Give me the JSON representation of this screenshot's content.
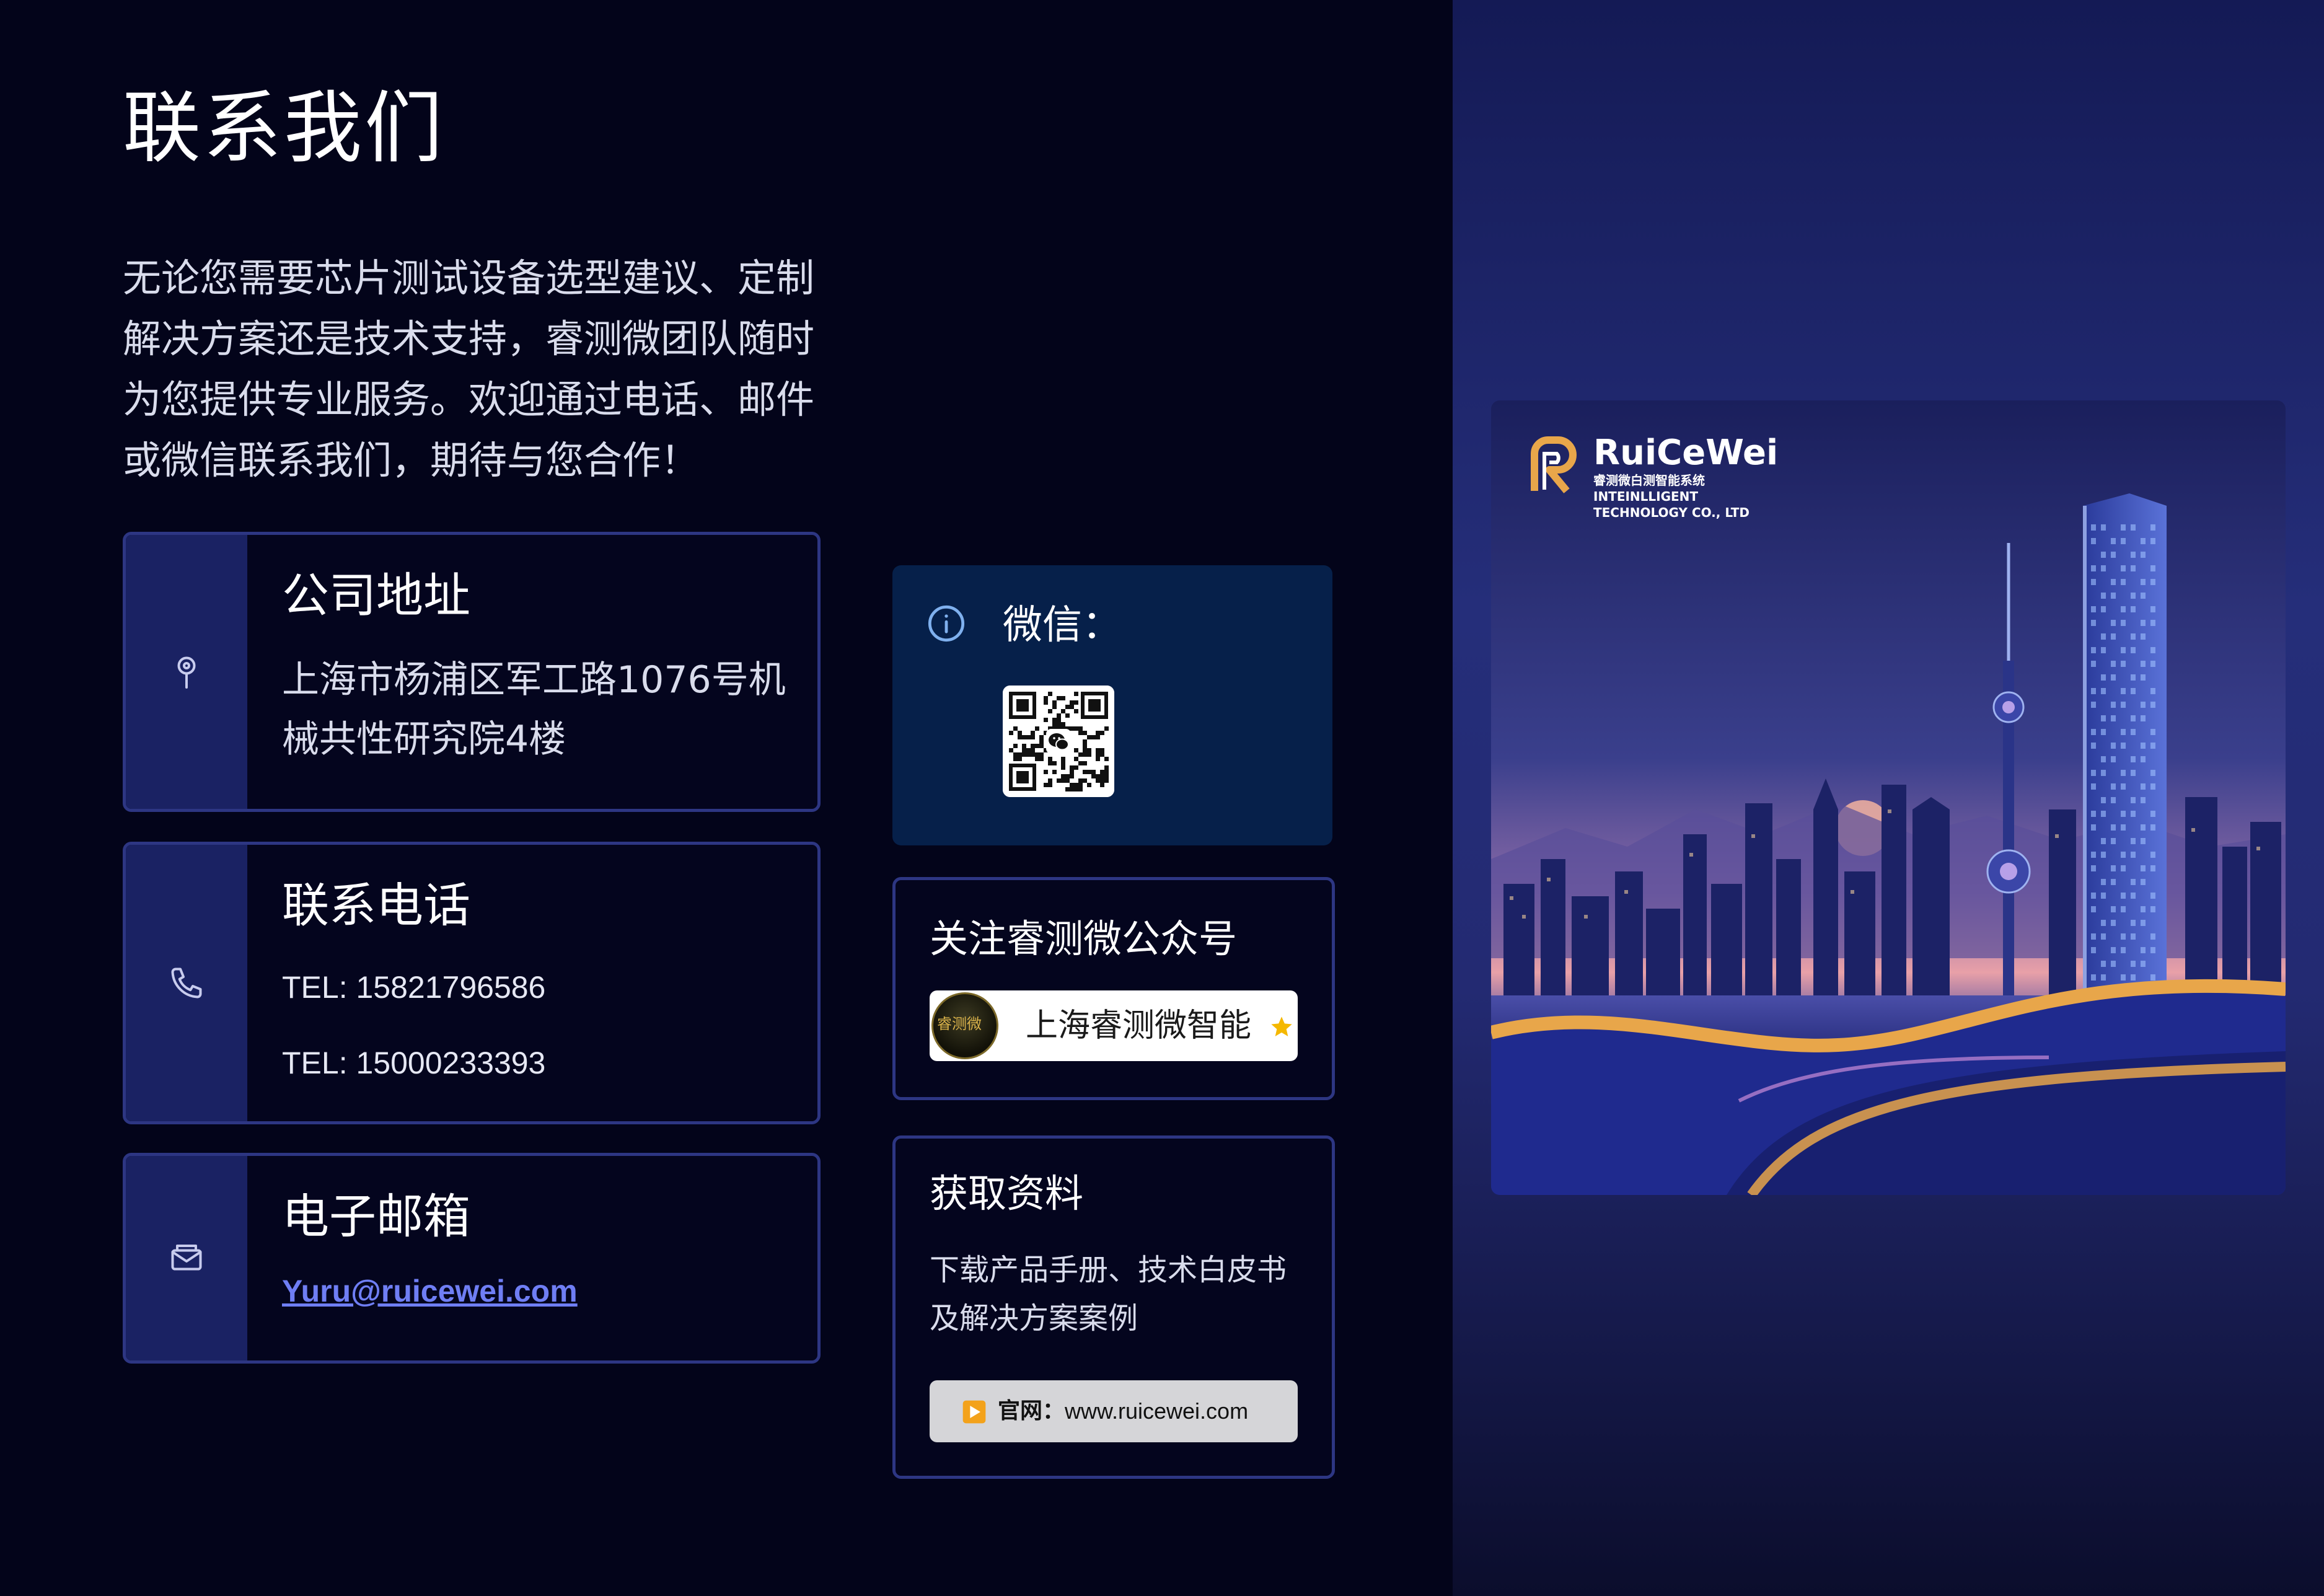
{
  "page": {
    "title": "联系我们",
    "intro_lines": [
      "无论您需要芯片测试设备选型建议、定制",
      "解决方案还是技术支持，睿测微团队随时",
      "为您提供专业服务。欢迎通过电话、邮件",
      "或微信联系我们，期待与您合作！"
    ]
  },
  "address": {
    "heading": "公司地址",
    "lines": [
      "上海市杨浦区军工路1076号机",
      "械共性研究院4楼"
    ],
    "icon": "map-pin-icon"
  },
  "phone": {
    "heading": "联系电话",
    "numbers": [
      "TEL: 15821796586",
      "TEL: 15000233393"
    ],
    "icon": "phone-icon"
  },
  "email": {
    "heading": "电子邮箱",
    "address": "Yuru@ruicewei.com",
    "icon": "mail-icon"
  },
  "wechat": {
    "label": "微信：",
    "icon": "info-icon",
    "qr": "wechat-qr-code"
  },
  "official_account": {
    "heading": "关注睿测微公众号",
    "name": "上海睿测微智能",
    "avatar_text": "睿测微",
    "star_icon": "star-icon"
  },
  "resources": {
    "heading": "获取资料",
    "desc_lines": [
      "下载产品手册、技术白皮书",
      "及解决方案案例"
    ],
    "site_label": "官网：",
    "site_url": "www.ruicewei.com",
    "play_icon": "play-icon"
  },
  "hero": {
    "brand_name": "RuiCeWei",
    "brand_tag": "睿测微白测智能系统",
    "brand_tag2": "INTEINLLIGENT",
    "brand_tag3": "TECHNOLOGY CO., LTD"
  },
  "colors": {
    "page_bg": "#03041a",
    "accent_blue": "#6f7ef4",
    "card_border": "#2d3683",
    "icon_column": "#1a2263",
    "wechat_bg": "#06204a",
    "star": "#f5b800",
    "brand_gold": "#e8a64a"
  }
}
